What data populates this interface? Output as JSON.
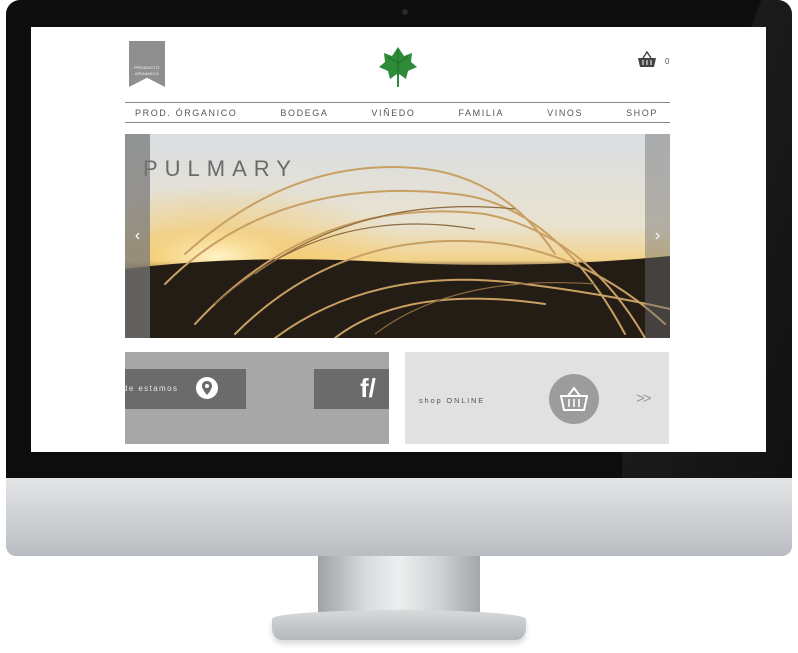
{
  "badge": {
    "line1": "PRODUCTO",
    "line2": "ORGÁNICO"
  },
  "cart": {
    "count": "0"
  },
  "nav": {
    "items": [
      "PROD. ÓRGANICO",
      "BODEGA",
      "VIÑEDO",
      "FAMILIA",
      "VINOS",
      "SHOP"
    ]
  },
  "hero": {
    "title": "PULMARY",
    "prev": "‹",
    "next": "›"
  },
  "panels": {
    "location_label": "de estamos",
    "facebook_label": "f/",
    "shop_label": "shop ONLINE",
    "more_label": ">>"
  },
  "colors": {
    "logo_green": "#2e8b3a",
    "panel_dark": "#6b6b6b",
    "panel_mid": "#a7a7a7",
    "panel_light": "#e1e1e1"
  }
}
